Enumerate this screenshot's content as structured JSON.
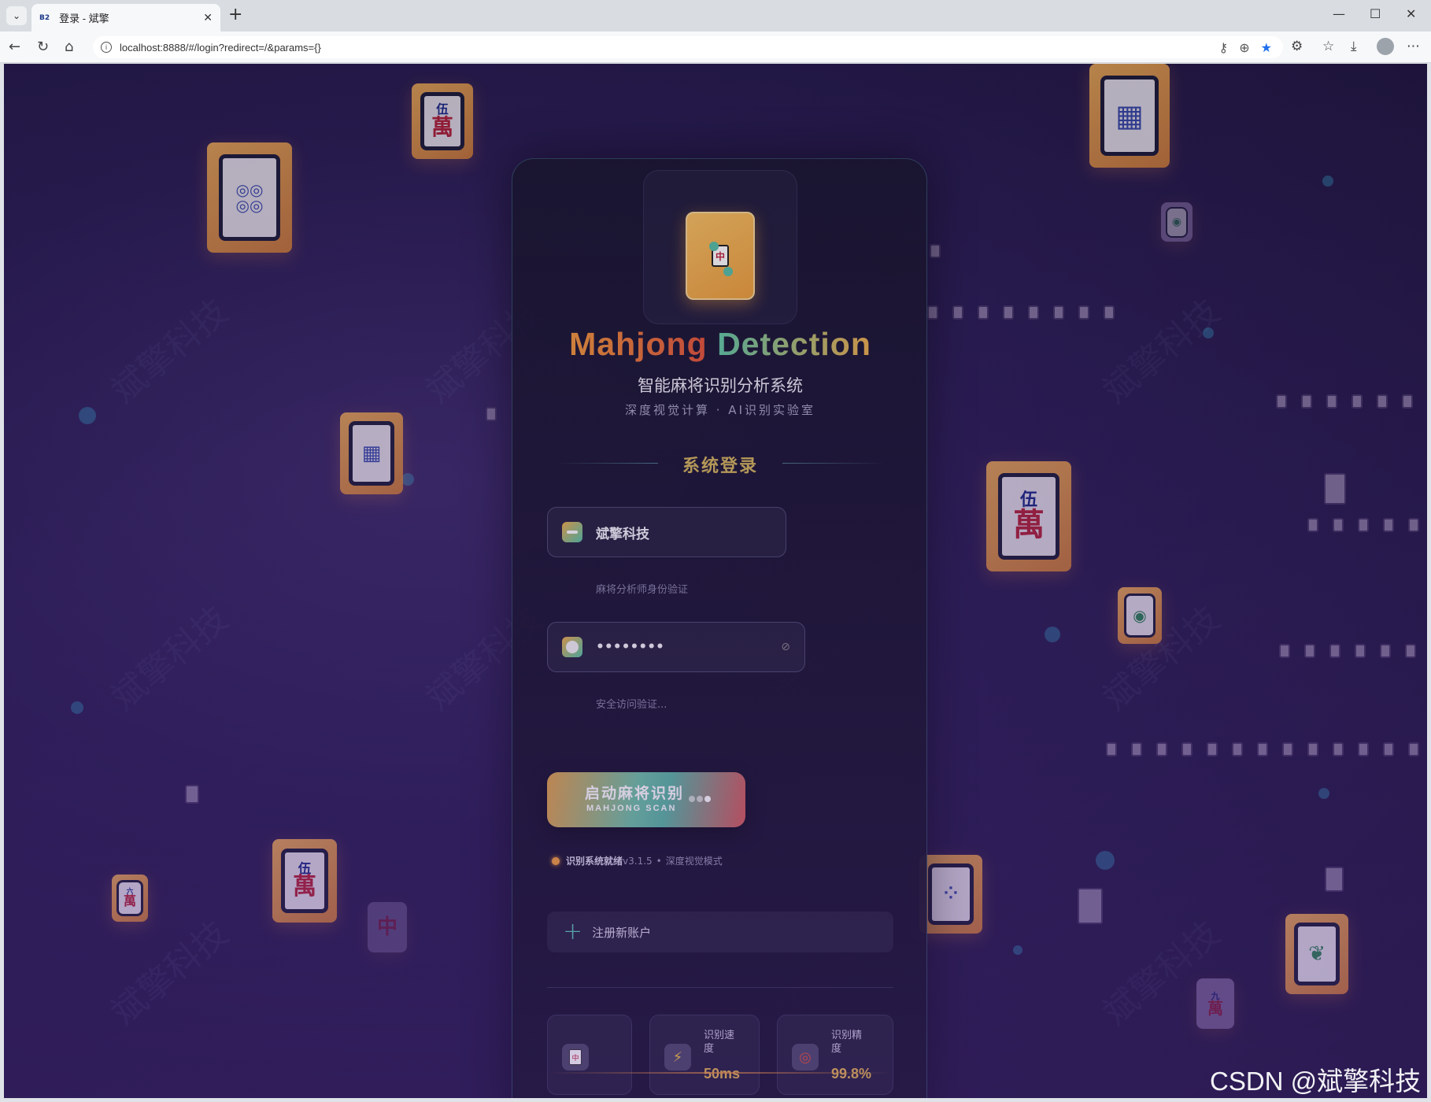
{
  "browser": {
    "tab_title": "登录 - 斌擎",
    "favicon_text": "B2",
    "url": "localhost:8888/#/login?redirect=/&params={}"
  },
  "card": {
    "brand_word1": "Mahjong",
    "brand_word2": "Detection",
    "subtitle": "智能麻将识别分析系统",
    "tagline": "深度视觉计算 · AI识别实验室",
    "section_title": "系统登录",
    "username": {
      "value": "斌擎科技",
      "hint": "麻将分析师身份验证"
    },
    "password": {
      "value": "••••••••",
      "hint": "安全访问验证..."
    },
    "scan_button": {
      "main": "启动麻将识别",
      "sub": "MAHJONG SCAN"
    },
    "status": {
      "ready": "识别系统就绪",
      "version": "v3.1.5",
      "separator": "•",
      "mode": "深度视觉模式"
    },
    "register_label": "注册新账户",
    "stats": [
      {
        "label": "识别速度",
        "value": "50ms",
        "icon": "lightning-icon"
      },
      {
        "label": "识别精度",
        "value": "99.8%",
        "icon": "target-icon"
      }
    ],
    "logo_tile_char": "中"
  },
  "watermark": "CSDN @斌擎科技",
  "colors": {
    "accent_orange": "#f39a3c",
    "accent_teal": "#62c9a6",
    "section_gold": "#d4b65c",
    "background": "#2a1d55"
  }
}
